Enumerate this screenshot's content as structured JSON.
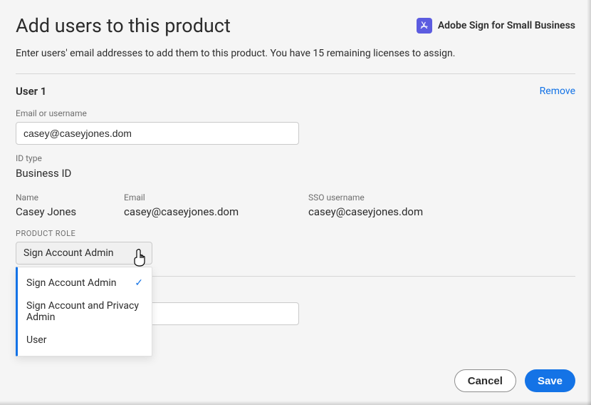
{
  "header": {
    "title": "Add users to this product",
    "product_icon": "adobe-acrobat-icon",
    "product_name": "Adobe Sign for Small Business",
    "subtitle": "Enter users' email addresses to add them to this product. You have 15 remaining licenses to assign."
  },
  "users": [
    {
      "label": "User 1",
      "remove_label": "Remove",
      "email_label": "Email or username",
      "email_value": "casey@caseyjones.dom",
      "id_type_label": "ID type",
      "id_type_value": "Business ID",
      "name_label": "Name",
      "name_value": "Casey Jones",
      "email_col_label": "Email",
      "email_col_value": "casey@caseyjones.dom",
      "sso_label": "SSO username",
      "sso_value": "casey@caseyjones.dom",
      "product_role_label": "PRODUCT ROLE",
      "product_role_selected": "Sign Account Admin",
      "product_role_options": [
        "Sign Account Admin",
        "Sign Account and Privacy Admin",
        "User"
      ]
    }
  ],
  "footer": {
    "cancel_label": "Cancel",
    "save_label": "Save"
  }
}
